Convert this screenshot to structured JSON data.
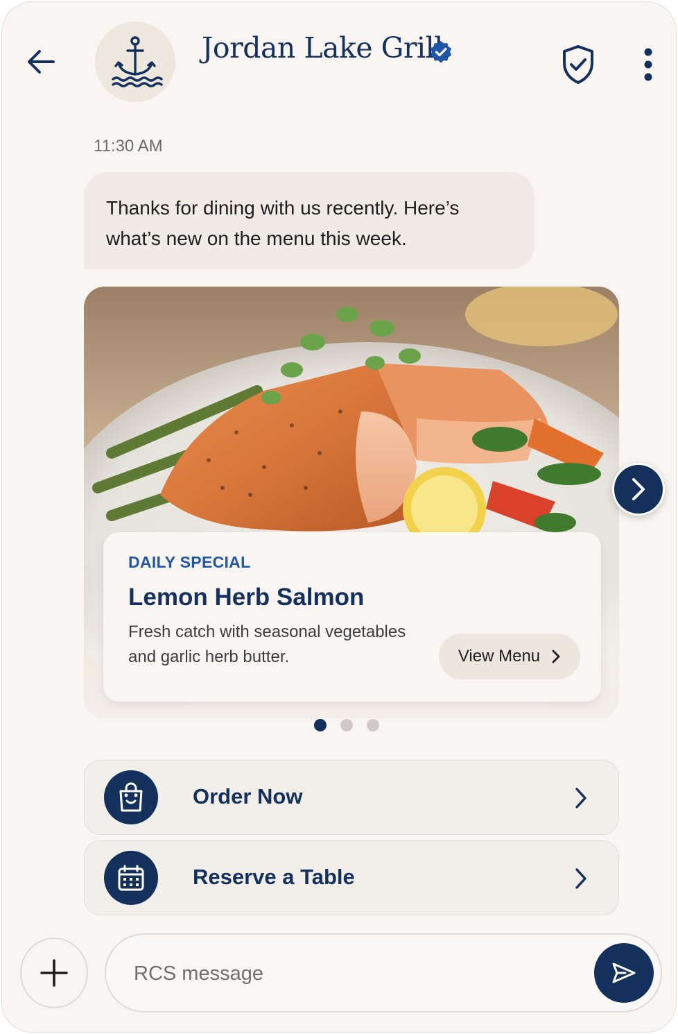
{
  "header": {
    "business_name": "Jordan Lake Grill",
    "verified": true,
    "icons": [
      "back-arrow-icon",
      "anchor-logo",
      "verified-badge-icon",
      "shield-check-icon",
      "more-vert-icon"
    ]
  },
  "conversation": {
    "timestamp": "11:30 AM",
    "message": "Thanks for dining with us recently. Here’s what’s new on the menu this week."
  },
  "rich_card": {
    "eyebrow": "DAILY SPECIAL",
    "title": "Lemon Herb Salmon",
    "description": "Fresh catch with seasonal vegetables and garlic herb butter.",
    "button_label": "View Menu",
    "carousel": {
      "total": 3,
      "active": 1
    }
  },
  "actions": [
    {
      "label": "Order Now",
      "icon": "shopping-bag-icon"
    },
    {
      "label": "Reserve a Table",
      "icon": "calendar-icon"
    }
  ],
  "composer": {
    "placeholder": "RCS message"
  },
  "colors": {
    "brand_navy": "#14305c",
    "accent_blue": "#1f56a8",
    "background": "#f8f5f2",
    "bubble": "#f0ebe5"
  }
}
